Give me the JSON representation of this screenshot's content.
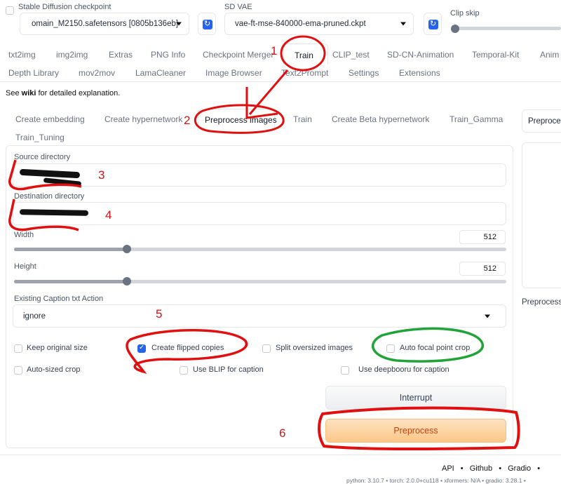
{
  "top": {
    "checkpoint_label": "Stable Diffusion checkpoint",
    "checkpoint_value": "omain_M2150.safetensors [0805b136eb]",
    "vae_label": "SD VAE",
    "vae_value": "vae-ft-mse-840000-ema-pruned.ckpt",
    "clip_label": "Clip skip"
  },
  "main_tabs_row1": [
    "txt2img",
    "img2img",
    "Extras",
    "PNG Info",
    "Checkpoint Merger",
    "Train",
    "CLIP_test",
    "SD-CN-Animation",
    "Temporal-Kit",
    "Anim"
  ],
  "main_tabs_row2": [
    "Depth Library",
    "mov2mov",
    "LamaCleaner",
    "Image Browser",
    "Text2Prompt",
    "Settings",
    "Extensions"
  ],
  "wiki": {
    "prefix": "See ",
    "link": "wiki",
    "suffix": " for detailed explanation."
  },
  "sub_tabs": [
    "Create embedding",
    "Create hypernetwork",
    "Preprocess images",
    "Train",
    "Create Beta hypernetwork",
    "Train_Gamma",
    "Train_Tuning"
  ],
  "form": {
    "source_label": "Source directory",
    "dest_label": "Destination directory",
    "width_label": "Width",
    "width_value": "512",
    "height_label": "Height",
    "height_value": "512",
    "caption_label": "Existing Caption txt Action",
    "caption_value": "ignore"
  },
  "checkboxes": {
    "keep_original": "Keep original size",
    "create_flipped": "Create flipped copies",
    "split_oversized": "Split oversized images",
    "auto_focal": "Auto focal point crop",
    "auto_sized": "Auto-sized crop",
    "use_blip": "Use BLIP for caption",
    "use_deepbooru": "Use deepbooru for caption"
  },
  "buttons": {
    "interrupt": "Interrupt",
    "preprocess": "Preprocess"
  },
  "right_panel": {
    "dropdown": "Preproce",
    "status": "Preprocessi"
  },
  "annotations": [
    "1",
    "2",
    "3",
    "4",
    "5",
    "6"
  ],
  "footer": {
    "links": [
      "API",
      "Github",
      "Gradio"
    ],
    "sep": "•",
    "versions": "python: 3.10.7  •  torch: 2.0.0+cu118  •  xformers: N/A  •  gradio: 3.28.1  •"
  },
  "colors": {
    "accent": "#2563eb",
    "preprocess_bg": "#fdc787",
    "preprocess_text": "#c2410c",
    "annotation_red": "#e01010",
    "annotation_green": "#22a33a"
  }
}
